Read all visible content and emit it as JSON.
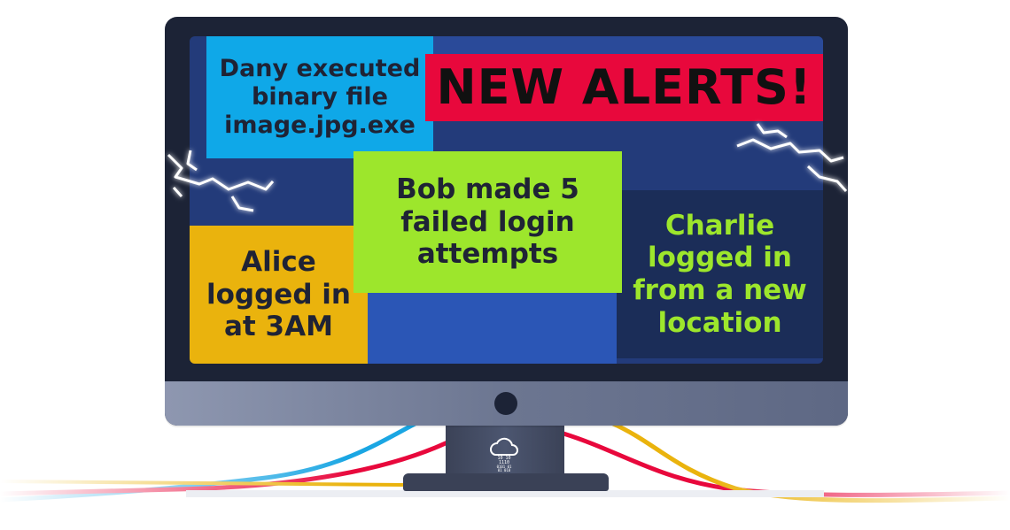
{
  "alerts": {
    "headline": "NEW ALERTS!",
    "dany": "Dany executed binary file image.jpg.exe",
    "bob": "Bob made 5 failed login attempts",
    "charlie": "Charlie logged in from a new location",
    "alice": "Alice logged in at 3AM"
  },
  "stand_logo": {
    "icon": "cloud-icon",
    "binary_lines": [
      "10  10",
      "1110",
      "0101 01",
      "01  010"
    ]
  },
  "colors": {
    "alert_red": "#e8083c",
    "dany_blue": "#0fa8e8",
    "bob_green": "#9de62c",
    "alice_yellow": "#eab30d",
    "charlie_navy": "#1b2d58",
    "screen_blue": "#233b7a"
  }
}
